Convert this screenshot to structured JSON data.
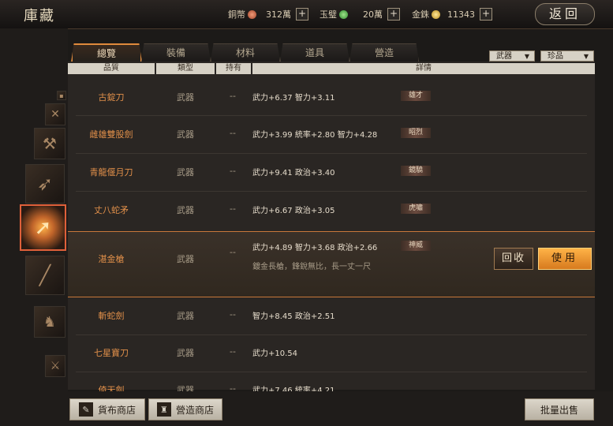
{
  "window": {
    "title": "庫藏",
    "back_label": "返回"
  },
  "currencies": [
    {
      "label": "銅幣",
      "value": "312萬",
      "coin_color": "#c2593a"
    },
    {
      "label": "玉璧",
      "value": "20萬",
      "coin_color": "#4caf50"
    },
    {
      "label": "金銖",
      "value": "11343",
      "coin_color": "#e3b63a"
    }
  ],
  "plus_label": "+",
  "tabs": [
    "總覽",
    "裝備",
    "材料",
    "道具",
    "營造"
  ],
  "active_tab": "總覽",
  "filters": {
    "category": "武器",
    "rarity": "珍品"
  },
  "columns": [
    "品質",
    "類型",
    "持有",
    "詳情"
  ],
  "rows": [
    {
      "name": "古錠刀",
      "type": "武器",
      "owned": "--",
      "stats": "武力+6.37  智力+3.11",
      "badge": "雄才"
    },
    {
      "name": "雌雄雙股劍",
      "type": "武器",
      "owned": "--",
      "stats": "武力+3.99  統率+2.80  智力+4.28",
      "badge": "昭烈"
    },
    {
      "name": "青龍偃月刀",
      "type": "武器",
      "owned": "--",
      "stats": "武力+9.41  政治+3.40",
      "badge": "鏡驍"
    },
    {
      "name": "丈八蛇矛",
      "type": "武器",
      "owned": "--",
      "stats": "武力+6.67  政治+3.05",
      "badge": "虎嘯"
    },
    {
      "name": "湛金槍",
      "type": "武器",
      "owned": "--",
      "stats": "武力+4.89  智力+3.68  政治+2.66",
      "badge": "神威",
      "desc": "鍍金長槍，鋒銳無比，長一丈一尺",
      "selected": true
    },
    {
      "name": "斬蛇劍",
      "type": "武器",
      "owned": "--",
      "stats": "智力+8.45  政治+2.51",
      "badge": ""
    },
    {
      "name": "七星寶刀",
      "type": "武器",
      "owned": "--",
      "stats": "武力+10.54",
      "badge": ""
    },
    {
      "name": "倚天劍",
      "type": "武器",
      "owned": "--",
      "stats": "武力+7.46  統率+4.21",
      "badge": ""
    }
  ],
  "actions": {
    "recycle": "回收",
    "use": "使用"
  },
  "bottom": {
    "shop1": "貨布商店",
    "shop2": "營造商店",
    "bulk_sell": "批量出售"
  },
  "icons": {
    "shop1": "pick-icon",
    "shop2": "tower-icon",
    "thumbs": [
      "small-box-icon",
      "crossed-swords-icon",
      "axe-icon",
      "bow-icon",
      "spear-icon",
      "staff-icon",
      "dragon-icon",
      "blade-icon"
    ]
  },
  "colors": {
    "accent": "#e08a3c",
    "quality_text": "#e08f4a",
    "use_button": "#ffb347"
  }
}
